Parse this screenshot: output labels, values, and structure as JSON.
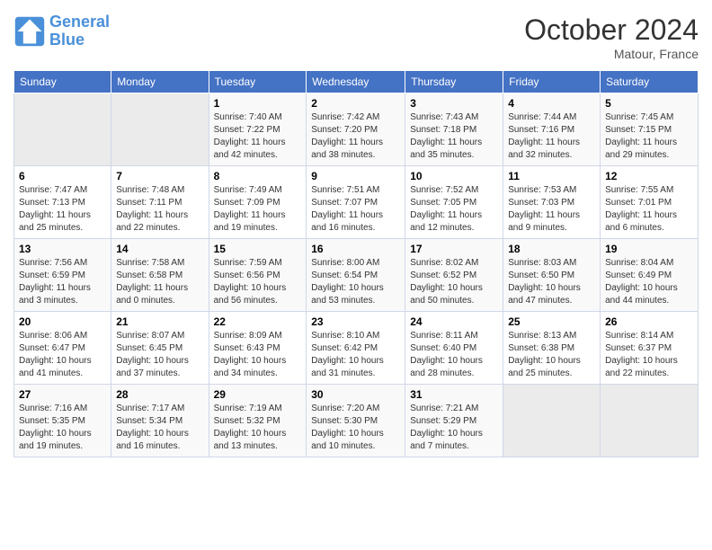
{
  "logo": {
    "line1": "General",
    "line2": "Blue"
  },
  "title": "October 2024",
  "subtitle": "Matour, France",
  "days_header": [
    "Sunday",
    "Monday",
    "Tuesday",
    "Wednesday",
    "Thursday",
    "Friday",
    "Saturday"
  ],
  "weeks": [
    [
      {
        "num": "",
        "sunrise": "",
        "sunset": "",
        "daylight": ""
      },
      {
        "num": "",
        "sunrise": "",
        "sunset": "",
        "daylight": ""
      },
      {
        "num": "1",
        "sunrise": "Sunrise: 7:40 AM",
        "sunset": "Sunset: 7:22 PM",
        "daylight": "Daylight: 11 hours and 42 minutes."
      },
      {
        "num": "2",
        "sunrise": "Sunrise: 7:42 AM",
        "sunset": "Sunset: 7:20 PM",
        "daylight": "Daylight: 11 hours and 38 minutes."
      },
      {
        "num": "3",
        "sunrise": "Sunrise: 7:43 AM",
        "sunset": "Sunset: 7:18 PM",
        "daylight": "Daylight: 11 hours and 35 minutes."
      },
      {
        "num": "4",
        "sunrise": "Sunrise: 7:44 AM",
        "sunset": "Sunset: 7:16 PM",
        "daylight": "Daylight: 11 hours and 32 minutes."
      },
      {
        "num": "5",
        "sunrise": "Sunrise: 7:45 AM",
        "sunset": "Sunset: 7:15 PM",
        "daylight": "Daylight: 11 hours and 29 minutes."
      }
    ],
    [
      {
        "num": "6",
        "sunrise": "Sunrise: 7:47 AM",
        "sunset": "Sunset: 7:13 PM",
        "daylight": "Daylight: 11 hours and 25 minutes."
      },
      {
        "num": "7",
        "sunrise": "Sunrise: 7:48 AM",
        "sunset": "Sunset: 7:11 PM",
        "daylight": "Daylight: 11 hours and 22 minutes."
      },
      {
        "num": "8",
        "sunrise": "Sunrise: 7:49 AM",
        "sunset": "Sunset: 7:09 PM",
        "daylight": "Daylight: 11 hours and 19 minutes."
      },
      {
        "num": "9",
        "sunrise": "Sunrise: 7:51 AM",
        "sunset": "Sunset: 7:07 PM",
        "daylight": "Daylight: 11 hours and 16 minutes."
      },
      {
        "num": "10",
        "sunrise": "Sunrise: 7:52 AM",
        "sunset": "Sunset: 7:05 PM",
        "daylight": "Daylight: 11 hours and 12 minutes."
      },
      {
        "num": "11",
        "sunrise": "Sunrise: 7:53 AM",
        "sunset": "Sunset: 7:03 PM",
        "daylight": "Daylight: 11 hours and 9 minutes."
      },
      {
        "num": "12",
        "sunrise": "Sunrise: 7:55 AM",
        "sunset": "Sunset: 7:01 PM",
        "daylight": "Daylight: 11 hours and 6 minutes."
      }
    ],
    [
      {
        "num": "13",
        "sunrise": "Sunrise: 7:56 AM",
        "sunset": "Sunset: 6:59 PM",
        "daylight": "Daylight: 11 hours and 3 minutes."
      },
      {
        "num": "14",
        "sunrise": "Sunrise: 7:58 AM",
        "sunset": "Sunset: 6:58 PM",
        "daylight": "Daylight: 11 hours and 0 minutes."
      },
      {
        "num": "15",
        "sunrise": "Sunrise: 7:59 AM",
        "sunset": "Sunset: 6:56 PM",
        "daylight": "Daylight: 10 hours and 56 minutes."
      },
      {
        "num": "16",
        "sunrise": "Sunrise: 8:00 AM",
        "sunset": "Sunset: 6:54 PM",
        "daylight": "Daylight: 10 hours and 53 minutes."
      },
      {
        "num": "17",
        "sunrise": "Sunrise: 8:02 AM",
        "sunset": "Sunset: 6:52 PM",
        "daylight": "Daylight: 10 hours and 50 minutes."
      },
      {
        "num": "18",
        "sunrise": "Sunrise: 8:03 AM",
        "sunset": "Sunset: 6:50 PM",
        "daylight": "Daylight: 10 hours and 47 minutes."
      },
      {
        "num": "19",
        "sunrise": "Sunrise: 8:04 AM",
        "sunset": "Sunset: 6:49 PM",
        "daylight": "Daylight: 10 hours and 44 minutes."
      }
    ],
    [
      {
        "num": "20",
        "sunrise": "Sunrise: 8:06 AM",
        "sunset": "Sunset: 6:47 PM",
        "daylight": "Daylight: 10 hours and 41 minutes."
      },
      {
        "num": "21",
        "sunrise": "Sunrise: 8:07 AM",
        "sunset": "Sunset: 6:45 PM",
        "daylight": "Daylight: 10 hours and 37 minutes."
      },
      {
        "num": "22",
        "sunrise": "Sunrise: 8:09 AM",
        "sunset": "Sunset: 6:43 PM",
        "daylight": "Daylight: 10 hours and 34 minutes."
      },
      {
        "num": "23",
        "sunrise": "Sunrise: 8:10 AM",
        "sunset": "Sunset: 6:42 PM",
        "daylight": "Daylight: 10 hours and 31 minutes."
      },
      {
        "num": "24",
        "sunrise": "Sunrise: 8:11 AM",
        "sunset": "Sunset: 6:40 PM",
        "daylight": "Daylight: 10 hours and 28 minutes."
      },
      {
        "num": "25",
        "sunrise": "Sunrise: 8:13 AM",
        "sunset": "Sunset: 6:38 PM",
        "daylight": "Daylight: 10 hours and 25 minutes."
      },
      {
        "num": "26",
        "sunrise": "Sunrise: 8:14 AM",
        "sunset": "Sunset: 6:37 PM",
        "daylight": "Daylight: 10 hours and 22 minutes."
      }
    ],
    [
      {
        "num": "27",
        "sunrise": "Sunrise: 7:16 AM",
        "sunset": "Sunset: 5:35 PM",
        "daylight": "Daylight: 10 hours and 19 minutes."
      },
      {
        "num": "28",
        "sunrise": "Sunrise: 7:17 AM",
        "sunset": "Sunset: 5:34 PM",
        "daylight": "Daylight: 10 hours and 16 minutes."
      },
      {
        "num": "29",
        "sunrise": "Sunrise: 7:19 AM",
        "sunset": "Sunset: 5:32 PM",
        "daylight": "Daylight: 10 hours and 13 minutes."
      },
      {
        "num": "30",
        "sunrise": "Sunrise: 7:20 AM",
        "sunset": "Sunset: 5:30 PM",
        "daylight": "Daylight: 10 hours and 10 minutes."
      },
      {
        "num": "31",
        "sunrise": "Sunrise: 7:21 AM",
        "sunset": "Sunset: 5:29 PM",
        "daylight": "Daylight: 10 hours and 7 minutes."
      },
      {
        "num": "",
        "sunrise": "",
        "sunset": "",
        "daylight": ""
      },
      {
        "num": "",
        "sunrise": "",
        "sunset": "",
        "daylight": ""
      }
    ]
  ]
}
